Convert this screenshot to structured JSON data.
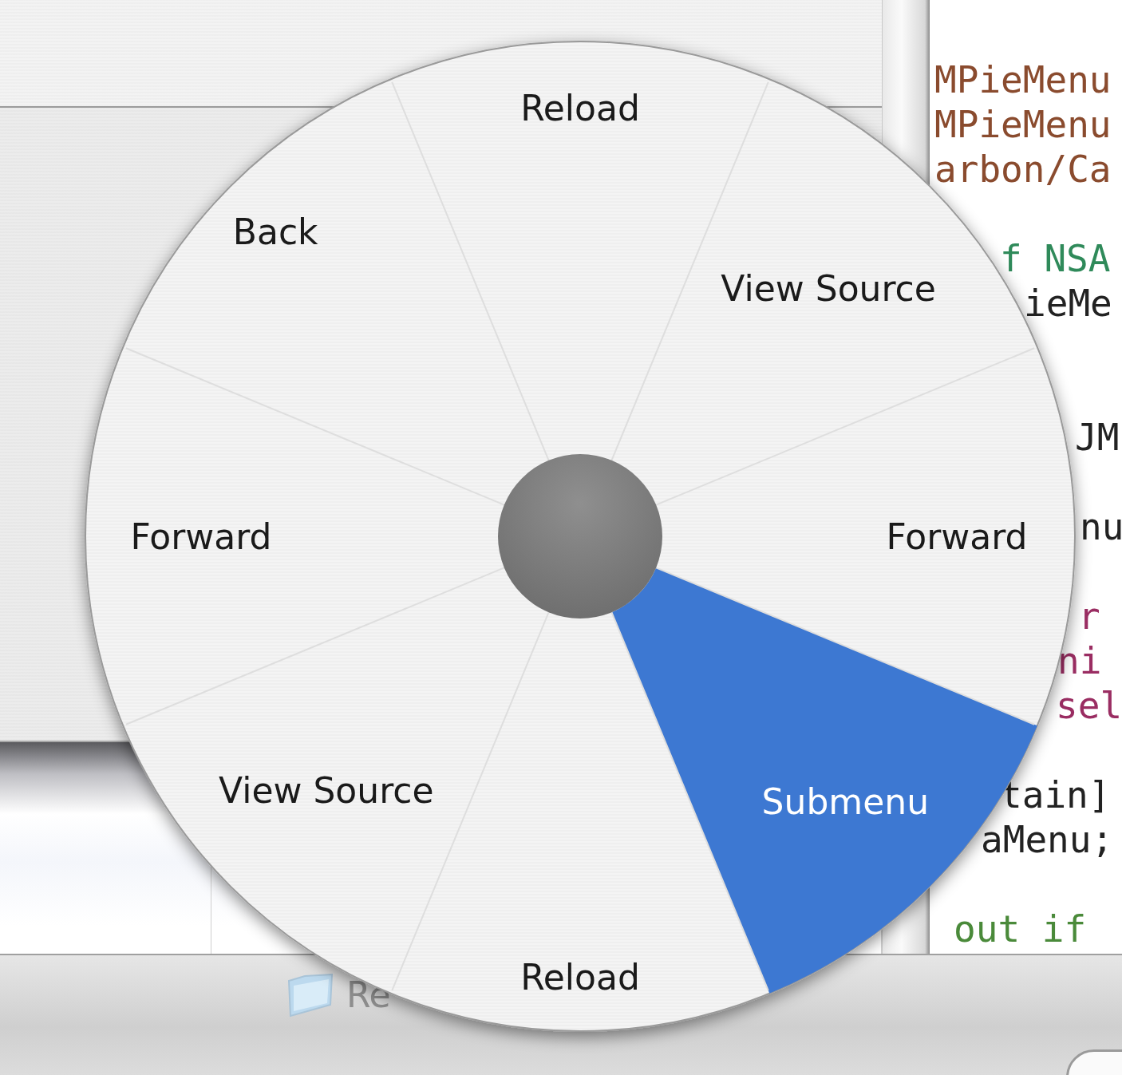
{
  "code_editor": {
    "lines": [
      {
        "text": "MPieMenu",
        "color": "#8a4b2e"
      },
      {
        "text": "MPieMenu",
        "color": "#8a4b2e"
      },
      {
        "text": "arbon/Ca",
        "color": "#8a4b2e"
      },
      {
        "text": "f NSA",
        "color": "#2f8a5a"
      },
      {
        "text": "ieMe",
        "color": "#222222"
      },
      {
        "text": "JM",
        "color": "#222222"
      },
      {
        "text": "nu",
        "color": "#222222"
      },
      {
        "text": "r",
        "color": "#9a2d62"
      },
      {
        "text": "ni",
        "color": "#9a2d62"
      },
      {
        "text": "sel",
        "color": "#9a2d62"
      },
      {
        "text": "tain]",
        "color": "#222222"
      },
      {
        "text": "aMenu;",
        "color": "#222222"
      },
      {
        "text": "out if",
        "color": "#4a8a3a"
      }
    ]
  },
  "bottom_bar": {
    "item_label": "Re"
  },
  "pie_menu": {
    "items": [
      {
        "label": "Reload",
        "selected": false
      },
      {
        "label": "View Source",
        "selected": false
      },
      {
        "label": "Forward",
        "selected": false
      },
      {
        "label": "Submenu",
        "selected": true
      },
      {
        "label": "Reload",
        "selected": false
      },
      {
        "label": "View Source",
        "selected": false
      },
      {
        "label": "Forward",
        "selected": false
      },
      {
        "label": "Back",
        "selected": false
      }
    ]
  }
}
